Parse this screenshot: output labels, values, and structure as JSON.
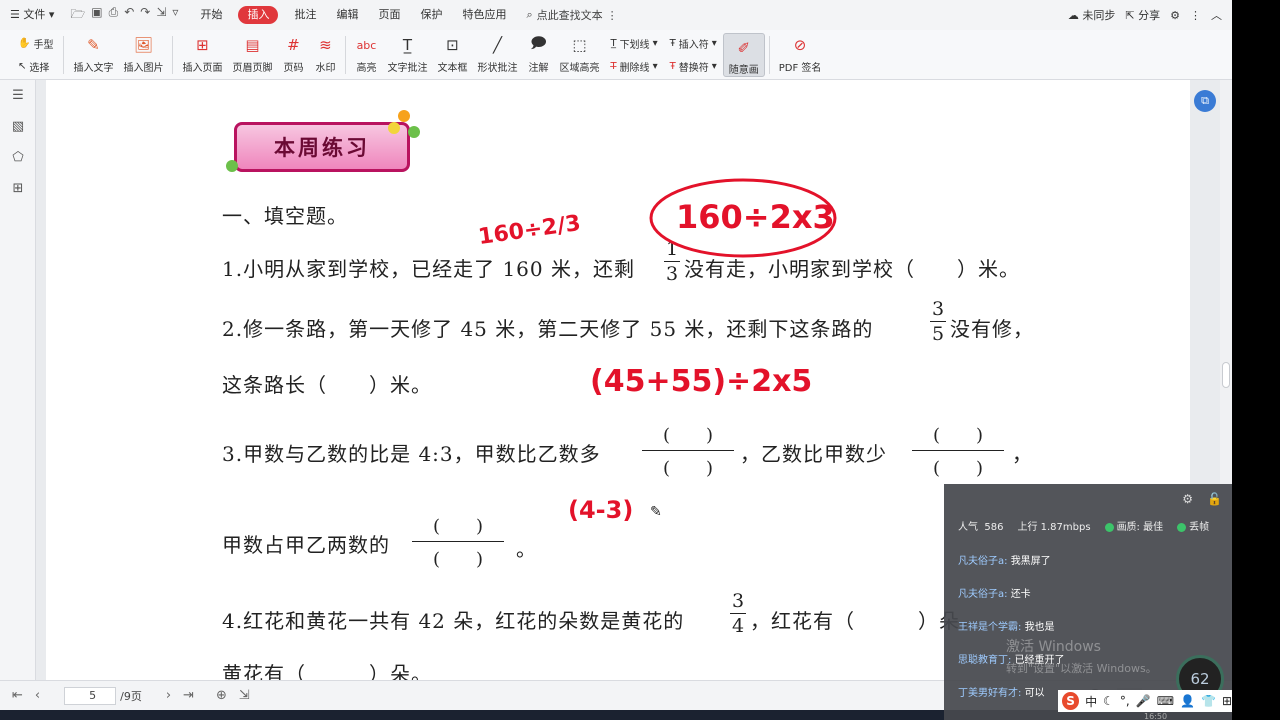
{
  "menubar": {
    "file_label": "文件",
    "tabs": [
      "开始",
      "插入",
      "批注",
      "编辑",
      "页面",
      "保护",
      "特色应用"
    ],
    "active_tab": "插入",
    "search_text": "点此查找文本",
    "sync_label": "未同步",
    "share_label": "分享"
  },
  "ribbon": {
    "hand_label": "手型",
    "select_label": "选择",
    "buttons": [
      "插入文字",
      "插入图片",
      "插入页面",
      "页眉页脚",
      "页码",
      "水印",
      "高亮",
      "文字批注",
      "文本框",
      "形状批注",
      "注解",
      "区域高亮"
    ],
    "underline_label": "下划线",
    "strike_label": "删除线",
    "insert_sym_label": "插入符",
    "replace_sym_label": "替换符",
    "freehand_label": "随意画",
    "pdf_sign_label": "PDF 签名"
  },
  "document": {
    "banner_title": "本周练习",
    "section_title": "一、填空题。",
    "q1": "1.小明从家到学校，已经走了 160 米，还剩",
    "q1_tail": "没有走，小明家到学校（　　）米。",
    "q1_frac": {
      "num": "1",
      "den": "3"
    },
    "q2": "2.修一条路，第一天修了 45 米，第二天修了 55 米，还剩下这条路的",
    "q2_frac": {
      "num": "3",
      "den": "5"
    },
    "q2_tail": "没有修，",
    "q2_line2": "这条路长（　　）米。",
    "q3": "3.甲数与乙数的比是 4:3，甲数比乙数多",
    "q3_mid": "，乙数比甲数少",
    "q3_end": "，",
    "q3_line2": "甲数占甲乙两数的",
    "q3_line2_end": "。",
    "blank_paren": "(　　)",
    "q4": "4.红花和黄花一共有 42 朵，红花的朵数是黄花的",
    "q4_frac": {
      "num": "3",
      "den": "4"
    },
    "q4_tail": "，红花有（　　　）朵，",
    "q4_line2": "黄花有（　　　）朵。"
  },
  "ink": {
    "note1": "160÷2/3",
    "note2": "160÷2x3",
    "note3": "(45+55)÷2x5",
    "note4": "(4-3)"
  },
  "statusbar": {
    "page_current": "5",
    "page_total": "/9页"
  },
  "live": {
    "popularity_label": "人气",
    "popularity": "586",
    "upload_label": "上行",
    "upload": "1.87mbps",
    "quality_label": "画质: 最佳",
    "drop_label": "丢帧",
    "chats": [
      {
        "user": "凡夫俗子a:",
        "msg": "我黑屏了"
      },
      {
        "user": "凡夫俗子a:",
        "msg": "还卡"
      },
      {
        "user": "王祥是个学霸:",
        "msg": "我也是"
      },
      {
        "user": "思聪教育丁:",
        "msg": "已经重开了"
      },
      {
        "user": "丁美男好有才:",
        "msg": "可以"
      }
    ],
    "watermark1": "激活 Windows",
    "watermark2": "转到\"设置\"以激活 Windows。",
    "gauge": "62",
    "clock": "16:50"
  },
  "ime": {
    "lang": "中"
  }
}
